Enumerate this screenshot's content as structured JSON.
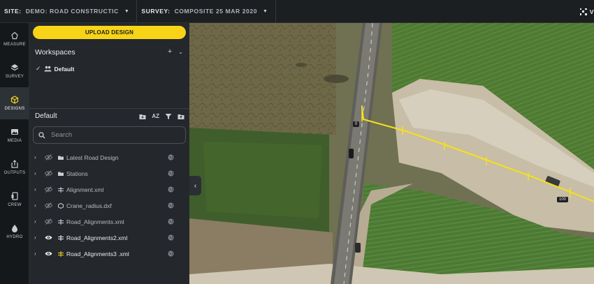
{
  "topbar": {
    "site_key": "SITE:",
    "site_value": "DEMO: ROAD CONSTRUCTIC",
    "survey_key": "SURVEY:",
    "survey_value": "COMPOSITE 25 MAR 2020",
    "right_label": "V"
  },
  "rail": {
    "items": [
      {
        "label": "MEASURE",
        "icon": "measure-icon"
      },
      {
        "label": "SURVEY",
        "icon": "layers-icon"
      },
      {
        "label": "DESIGNS",
        "icon": "cube-icon",
        "active": true
      },
      {
        "label": "MEDIA",
        "icon": "image-icon"
      },
      {
        "label": "OUTPUTS",
        "icon": "share-icon"
      },
      {
        "label": "CREW",
        "icon": "phone-icon"
      },
      {
        "label": "HYDRO",
        "icon": "droplet-icon"
      }
    ]
  },
  "panel": {
    "upload_label": "UPLOAD DESIGN",
    "workspaces_title": "Workspaces",
    "workspace_active": "Default",
    "default_title": "Default",
    "sort_label": "AZ",
    "search_placeholder": "Search",
    "layers": [
      {
        "name": "Latest Road Design",
        "type": "folder-icon",
        "visible": false
      },
      {
        "name": "Stations",
        "type": "folder-icon",
        "visible": false
      },
      {
        "name": "Alignment.xml",
        "type": "alignment-icon",
        "visible": false
      },
      {
        "name": "Crane_radius.dxf",
        "type": "cad-icon",
        "visible": false
      },
      {
        "name": "Road_Alignments.xml",
        "type": "alignment-icon",
        "visible": false
      },
      {
        "name": "Road_Alignments2.xml",
        "type": "alignment-icon",
        "visible": true
      },
      {
        "name": "Road_Alignments3 .xml",
        "type": "alignment-icon",
        "visible": true,
        "accent": "#f7d417"
      }
    ]
  },
  "map": {
    "station_start": "0",
    "station_end": "100",
    "alignment_color": "#f5e21a"
  }
}
